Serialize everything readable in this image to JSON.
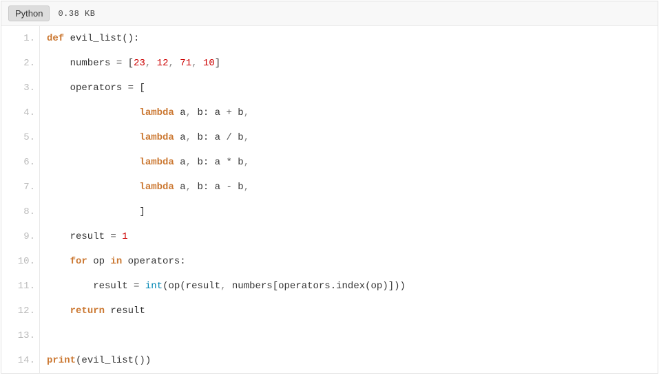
{
  "header": {
    "language": "Python",
    "size": "0.38 KB"
  },
  "code": {
    "lines": [
      {
        "n": "1.",
        "tokens": [
          {
            "t": "def ",
            "c": "kw"
          },
          {
            "t": "evil_list",
            "c": "fn"
          },
          {
            "t": "():",
            "c": "p"
          }
        ]
      },
      {
        "n": "2.",
        "tokens": [
          {
            "t": "    numbers ",
            "c": "fn"
          },
          {
            "t": "=",
            "c": "op"
          },
          {
            "t": " [",
            "c": "p"
          },
          {
            "t": "23",
            "c": "num"
          },
          {
            "t": ", ",
            "c": "comma"
          },
          {
            "t": "12",
            "c": "num"
          },
          {
            "t": ", ",
            "c": "comma"
          },
          {
            "t": "71",
            "c": "num"
          },
          {
            "t": ", ",
            "c": "comma"
          },
          {
            "t": "10",
            "c": "num"
          },
          {
            "t": "]",
            "c": "p"
          }
        ]
      },
      {
        "n": "3.",
        "tokens": [
          {
            "t": "    operators ",
            "c": "fn"
          },
          {
            "t": "=",
            "c": "op"
          },
          {
            "t": " [",
            "c": "p"
          }
        ]
      },
      {
        "n": "4.",
        "tokens": [
          {
            "t": "                ",
            "c": "p"
          },
          {
            "t": "lambda",
            "c": "kw2"
          },
          {
            "t": " a",
            "c": "fn"
          },
          {
            "t": ",",
            "c": "comma"
          },
          {
            "t": " b: a ",
            "c": "fn"
          },
          {
            "t": "+",
            "c": "op"
          },
          {
            "t": " b",
            "c": "fn"
          },
          {
            "t": ",",
            "c": "comma"
          }
        ]
      },
      {
        "n": "5.",
        "tokens": [
          {
            "t": "                ",
            "c": "p"
          },
          {
            "t": "lambda",
            "c": "kw2"
          },
          {
            "t": " a",
            "c": "fn"
          },
          {
            "t": ",",
            "c": "comma"
          },
          {
            "t": " b: a ",
            "c": "fn"
          },
          {
            "t": "/",
            "c": "op"
          },
          {
            "t": " b",
            "c": "fn"
          },
          {
            "t": ",",
            "c": "comma"
          }
        ]
      },
      {
        "n": "6.",
        "tokens": [
          {
            "t": "                ",
            "c": "p"
          },
          {
            "t": "lambda",
            "c": "kw2"
          },
          {
            "t": " a",
            "c": "fn"
          },
          {
            "t": ",",
            "c": "comma"
          },
          {
            "t": " b: a ",
            "c": "fn"
          },
          {
            "t": "*",
            "c": "op"
          },
          {
            "t": " b",
            "c": "fn"
          },
          {
            "t": ",",
            "c": "comma"
          }
        ]
      },
      {
        "n": "7.",
        "tokens": [
          {
            "t": "                ",
            "c": "p"
          },
          {
            "t": "lambda",
            "c": "kw2"
          },
          {
            "t": " a",
            "c": "fn"
          },
          {
            "t": ",",
            "c": "comma"
          },
          {
            "t": " b: a ",
            "c": "fn"
          },
          {
            "t": "-",
            "c": "op"
          },
          {
            "t": " b",
            "c": "fn"
          },
          {
            "t": ",",
            "c": "comma"
          }
        ]
      },
      {
        "n": "8.",
        "tokens": [
          {
            "t": "                ]",
            "c": "p"
          }
        ]
      },
      {
        "n": "9.",
        "tokens": [
          {
            "t": "    result ",
            "c": "fn"
          },
          {
            "t": "=",
            "c": "op"
          },
          {
            "t": " ",
            "c": "p"
          },
          {
            "t": "1",
            "c": "num"
          }
        ]
      },
      {
        "n": "10.",
        "tokens": [
          {
            "t": "    ",
            "c": "p"
          },
          {
            "t": "for",
            "c": "kw"
          },
          {
            "t": " op ",
            "c": "fn"
          },
          {
            "t": "in",
            "c": "kw"
          },
          {
            "t": " operators:",
            "c": "fn"
          }
        ]
      },
      {
        "n": "11.",
        "tokens": [
          {
            "t": "        result ",
            "c": "fn"
          },
          {
            "t": "=",
            "c": "op"
          },
          {
            "t": " ",
            "c": "p"
          },
          {
            "t": "int",
            "c": "builtin"
          },
          {
            "t": "(op(result",
            "c": "fn"
          },
          {
            "t": ",",
            "c": "comma"
          },
          {
            "t": " numbers[operators.index(op)]))",
            "c": "fn"
          }
        ]
      },
      {
        "n": "12.",
        "tokens": [
          {
            "t": "    ",
            "c": "p"
          },
          {
            "t": "return",
            "c": "kw"
          },
          {
            "t": " result",
            "c": "fn"
          }
        ]
      },
      {
        "n": "13.",
        "tokens": [
          {
            "t": " ",
            "c": "p"
          }
        ]
      },
      {
        "n": "14.",
        "tokens": [
          {
            "t": "print",
            "c": "kw"
          },
          {
            "t": "(evil_list())",
            "c": "fn"
          }
        ]
      }
    ]
  }
}
